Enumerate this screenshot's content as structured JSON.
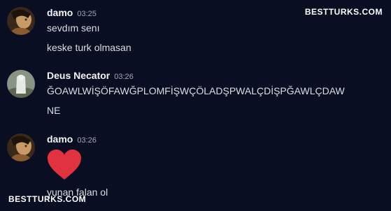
{
  "watermark": {
    "top": "BESTTURKS.COM",
    "bottom": "BESTTURKS.COM"
  },
  "messages": [
    {
      "username": "damo",
      "time": "03:25",
      "lines": [
        "sevdım senı",
        "keske turk olmasan"
      ]
    },
    {
      "username": "Deus Necator",
      "time": "03:26",
      "lines": [
        "ĞOAWLWİŞÖFAWĞPLOMFİŞWÇÖLADŞPWALÇDİŞPĞAWLÇDAW",
        "NE"
      ]
    },
    {
      "username": "damo",
      "time": "03:26",
      "emoji": "red-heart",
      "lines": [
        "yunan falan ol"
      ]
    }
  ],
  "colors": {
    "background": "#0a0e22",
    "username": "#f2f3f5",
    "text": "#dbdee1",
    "timestamp": "#a3a6b4",
    "heart": "#e0323f"
  }
}
